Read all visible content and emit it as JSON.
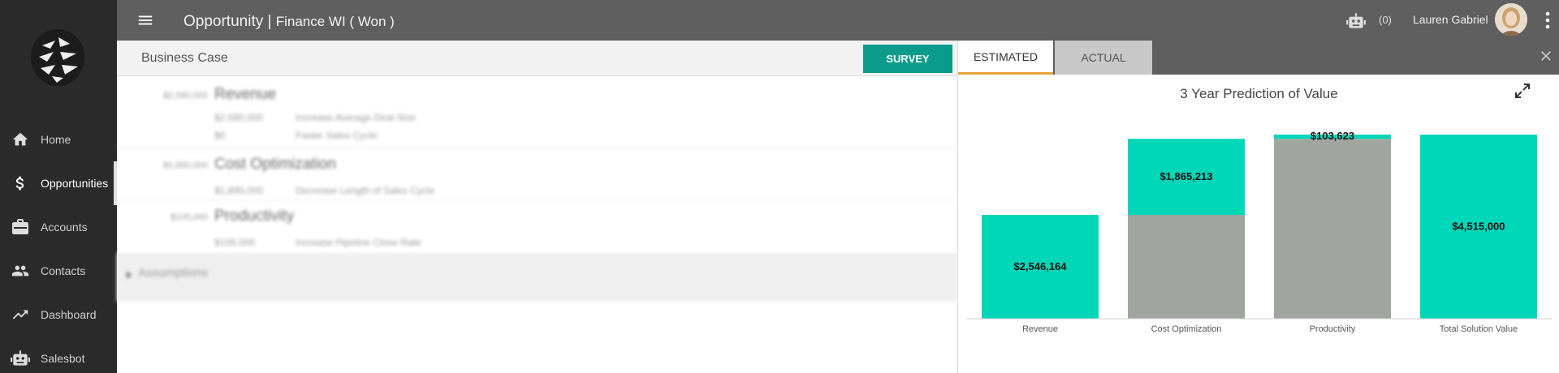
{
  "header": {
    "title": "Opportunity | ",
    "subtitle": "Finance WI ( Won )",
    "bot_count": "(0)",
    "user_name": "Lauren Gabriel"
  },
  "sidebar": {
    "items": [
      {
        "label": "Home",
        "icon": "home-icon"
      },
      {
        "label": "Opportunities",
        "icon": "dollar-icon",
        "active": true
      },
      {
        "label": "Accounts",
        "icon": "briefcase-icon"
      },
      {
        "label": "Contacts",
        "icon": "people-icon"
      },
      {
        "label": "Dashboard",
        "icon": "trending-up-icon"
      },
      {
        "label": "Salesbot",
        "icon": "robot-icon"
      }
    ]
  },
  "business_case": {
    "title": "Business Case",
    "survey_label": "SURVEY",
    "sections": [
      {
        "amount": "$2,580,000",
        "title": "Revenue",
        "items": [
          {
            "amount": "$2,580,000",
            "label": "Increase Average Deal Size"
          },
          {
            "amount": "$0",
            "label": "Faster Sales Cycle"
          }
        ]
      },
      {
        "amount": "$1,890,000",
        "title": "Cost Optimization",
        "items": [
          {
            "amount": "$1,890,000",
            "label": "Decrease Length of Sales Cycle"
          }
        ]
      },
      {
        "amount": "$105,000",
        "title": "Productivity",
        "items": [
          {
            "amount": "$105,000",
            "label": "Increase Pipeline Close Rate"
          }
        ]
      }
    ],
    "assumptions_label": "Assumptions"
  },
  "panel": {
    "tabs": [
      {
        "label": "ESTIMATED",
        "active": true
      },
      {
        "label": "ACTUAL",
        "active": false
      }
    ]
  },
  "colors": {
    "accent": "#00d6b8",
    "base": "#a0a69f",
    "survey": "#0a9b8a",
    "tab_underline": "#e8a33a"
  },
  "chart_data": {
    "type": "bar",
    "title": "3 Year Prediction of Value",
    "categories": [
      "Revenue",
      "Cost Optimization",
      "Productivity",
      "Total Solution Value"
    ],
    "bars": [
      {
        "base": 0,
        "value": 2546164,
        "label": "$2,546,164"
      },
      {
        "base": 2546164,
        "value": 1865213,
        "label": "$1,865,213"
      },
      {
        "base": 4411377,
        "value": 103623,
        "label": "$103,623"
      },
      {
        "base": 0,
        "value": 4515000,
        "label": "$4,515,000"
      }
    ],
    "ylim": [
      0,
      4515000
    ],
    "waterfall": true
  }
}
